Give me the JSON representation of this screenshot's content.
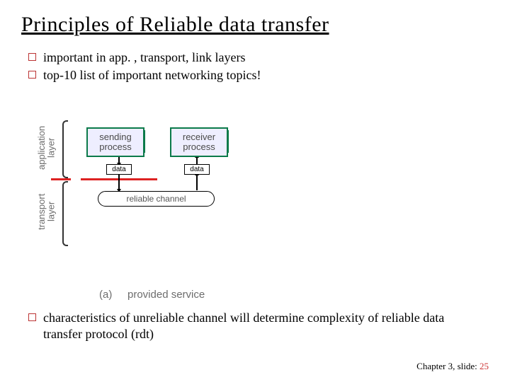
{
  "title": "Principles of Reliable data transfer",
  "bullets": {
    "b1": "important in app. , transport, link layers",
    "b2": "top-10 list of important networking topics!"
  },
  "diagram": {
    "layer_app": "application\nlayer",
    "layer_trans": "transport\nlayer",
    "sending": "sending\nprocess",
    "receiver": "receiver\nprocess",
    "data": "data",
    "channel": "reliable channel",
    "caption_a": "(a)",
    "caption_label": "provided service"
  },
  "bottom": {
    "text": "characteristics of unreliable channel will determine complexity of reliable data transfer protocol (rdt)"
  },
  "footer": {
    "chapter": "Chapter 3, slide:",
    "page": "25"
  }
}
